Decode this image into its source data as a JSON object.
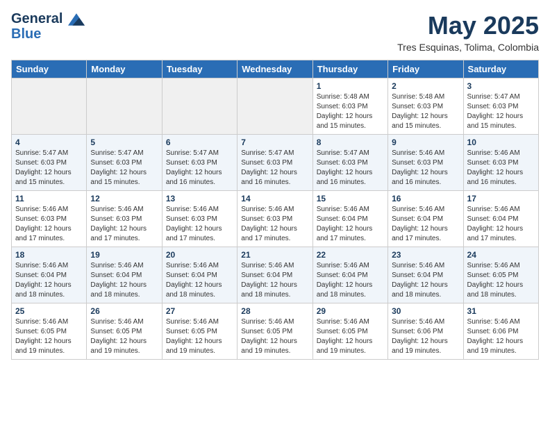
{
  "header": {
    "logo_line1": "General",
    "logo_line2": "Blue",
    "title": "May 2025",
    "subtitle": "Tres Esquinas, Tolima, Colombia"
  },
  "days_of_week": [
    "Sunday",
    "Monday",
    "Tuesday",
    "Wednesday",
    "Thursday",
    "Friday",
    "Saturday"
  ],
  "weeks": [
    [
      {
        "day": "",
        "info": ""
      },
      {
        "day": "",
        "info": ""
      },
      {
        "day": "",
        "info": ""
      },
      {
        "day": "",
        "info": ""
      },
      {
        "day": "1",
        "info": "Sunrise: 5:48 AM\nSunset: 6:03 PM\nDaylight: 12 hours\nand 15 minutes."
      },
      {
        "day": "2",
        "info": "Sunrise: 5:48 AM\nSunset: 6:03 PM\nDaylight: 12 hours\nand 15 minutes."
      },
      {
        "day": "3",
        "info": "Sunrise: 5:47 AM\nSunset: 6:03 PM\nDaylight: 12 hours\nand 15 minutes."
      }
    ],
    [
      {
        "day": "4",
        "info": "Sunrise: 5:47 AM\nSunset: 6:03 PM\nDaylight: 12 hours\nand 15 minutes."
      },
      {
        "day": "5",
        "info": "Sunrise: 5:47 AM\nSunset: 6:03 PM\nDaylight: 12 hours\nand 15 minutes."
      },
      {
        "day": "6",
        "info": "Sunrise: 5:47 AM\nSunset: 6:03 PM\nDaylight: 12 hours\nand 16 minutes."
      },
      {
        "day": "7",
        "info": "Sunrise: 5:47 AM\nSunset: 6:03 PM\nDaylight: 12 hours\nand 16 minutes."
      },
      {
        "day": "8",
        "info": "Sunrise: 5:47 AM\nSunset: 6:03 PM\nDaylight: 12 hours\nand 16 minutes."
      },
      {
        "day": "9",
        "info": "Sunrise: 5:46 AM\nSunset: 6:03 PM\nDaylight: 12 hours\nand 16 minutes."
      },
      {
        "day": "10",
        "info": "Sunrise: 5:46 AM\nSunset: 6:03 PM\nDaylight: 12 hours\nand 16 minutes."
      }
    ],
    [
      {
        "day": "11",
        "info": "Sunrise: 5:46 AM\nSunset: 6:03 PM\nDaylight: 12 hours\nand 17 minutes."
      },
      {
        "day": "12",
        "info": "Sunrise: 5:46 AM\nSunset: 6:03 PM\nDaylight: 12 hours\nand 17 minutes."
      },
      {
        "day": "13",
        "info": "Sunrise: 5:46 AM\nSunset: 6:03 PM\nDaylight: 12 hours\nand 17 minutes."
      },
      {
        "day": "14",
        "info": "Sunrise: 5:46 AM\nSunset: 6:03 PM\nDaylight: 12 hours\nand 17 minutes."
      },
      {
        "day": "15",
        "info": "Sunrise: 5:46 AM\nSunset: 6:04 PM\nDaylight: 12 hours\nand 17 minutes."
      },
      {
        "day": "16",
        "info": "Sunrise: 5:46 AM\nSunset: 6:04 PM\nDaylight: 12 hours\nand 17 minutes."
      },
      {
        "day": "17",
        "info": "Sunrise: 5:46 AM\nSunset: 6:04 PM\nDaylight: 12 hours\nand 17 minutes."
      }
    ],
    [
      {
        "day": "18",
        "info": "Sunrise: 5:46 AM\nSunset: 6:04 PM\nDaylight: 12 hours\nand 18 minutes."
      },
      {
        "day": "19",
        "info": "Sunrise: 5:46 AM\nSunset: 6:04 PM\nDaylight: 12 hours\nand 18 minutes."
      },
      {
        "day": "20",
        "info": "Sunrise: 5:46 AM\nSunset: 6:04 PM\nDaylight: 12 hours\nand 18 minutes."
      },
      {
        "day": "21",
        "info": "Sunrise: 5:46 AM\nSunset: 6:04 PM\nDaylight: 12 hours\nand 18 minutes."
      },
      {
        "day": "22",
        "info": "Sunrise: 5:46 AM\nSunset: 6:04 PM\nDaylight: 12 hours\nand 18 minutes."
      },
      {
        "day": "23",
        "info": "Sunrise: 5:46 AM\nSunset: 6:04 PM\nDaylight: 12 hours\nand 18 minutes."
      },
      {
        "day": "24",
        "info": "Sunrise: 5:46 AM\nSunset: 6:05 PM\nDaylight: 12 hours\nand 18 minutes."
      }
    ],
    [
      {
        "day": "25",
        "info": "Sunrise: 5:46 AM\nSunset: 6:05 PM\nDaylight: 12 hours\nand 19 minutes."
      },
      {
        "day": "26",
        "info": "Sunrise: 5:46 AM\nSunset: 6:05 PM\nDaylight: 12 hours\nand 19 minutes."
      },
      {
        "day": "27",
        "info": "Sunrise: 5:46 AM\nSunset: 6:05 PM\nDaylight: 12 hours\nand 19 minutes."
      },
      {
        "day": "28",
        "info": "Sunrise: 5:46 AM\nSunset: 6:05 PM\nDaylight: 12 hours\nand 19 minutes."
      },
      {
        "day": "29",
        "info": "Sunrise: 5:46 AM\nSunset: 6:05 PM\nDaylight: 12 hours\nand 19 minutes."
      },
      {
        "day": "30",
        "info": "Sunrise: 5:46 AM\nSunset: 6:06 PM\nDaylight: 12 hours\nand 19 minutes."
      },
      {
        "day": "31",
        "info": "Sunrise: 5:46 AM\nSunset: 6:06 PM\nDaylight: 12 hours\nand 19 minutes."
      }
    ]
  ]
}
